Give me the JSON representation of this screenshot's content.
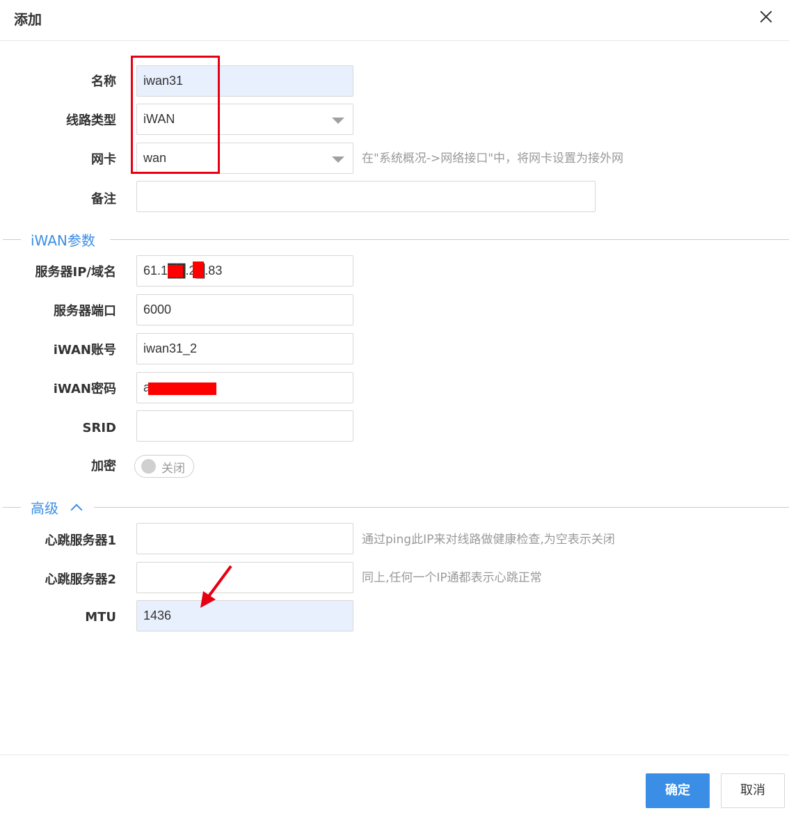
{
  "dialog": {
    "title": "添加"
  },
  "form": {
    "name": {
      "label": "名称",
      "value": "iwan31"
    },
    "line_type": {
      "label": "线路类型",
      "value": "iWAN"
    },
    "nic": {
      "label": "网卡",
      "value": "wan",
      "hint": "在\"系统概况->网络接口\"中，将网卡设置为接外网"
    },
    "remark": {
      "label": "备注",
      "value": ""
    }
  },
  "iwan_section": {
    "title": "iWAN参数",
    "server_ip": {
      "label": "服务器IP/域名",
      "value": "61.1██.2█.83"
    },
    "server_port": {
      "label": "服务器端口",
      "value": "6000"
    },
    "account": {
      "label": "iWAN账号",
      "value": "iwan31_2"
    },
    "password": {
      "label": "iWAN密码",
      "value": "a"
    },
    "srid": {
      "label": "SRID",
      "value": ""
    },
    "encrypt": {
      "label": "加密",
      "toggle_text": "关闭"
    }
  },
  "advanced_section": {
    "title": "高级",
    "heartbeat1": {
      "label": "心跳服务器1",
      "value": "",
      "hint": "通过ping此IP来对线路做健康检查,为空表示关闭"
    },
    "heartbeat2": {
      "label": "心跳服务器2",
      "value": "",
      "hint": "同上,任何一个IP通都表示心跳正常"
    },
    "mtu": {
      "label": "MTU",
      "value": "1436"
    }
  },
  "footer": {
    "confirm_label": "确定",
    "cancel_label": "取消"
  },
  "colors": {
    "accent": "#3a8ee6",
    "annotation_red": "#e60012",
    "autofill_bg": "#e8f0fe"
  },
  "icons": {
    "close": "close-icon",
    "select": "chevron-down-icon",
    "collapse": "chevron-up-icon"
  }
}
